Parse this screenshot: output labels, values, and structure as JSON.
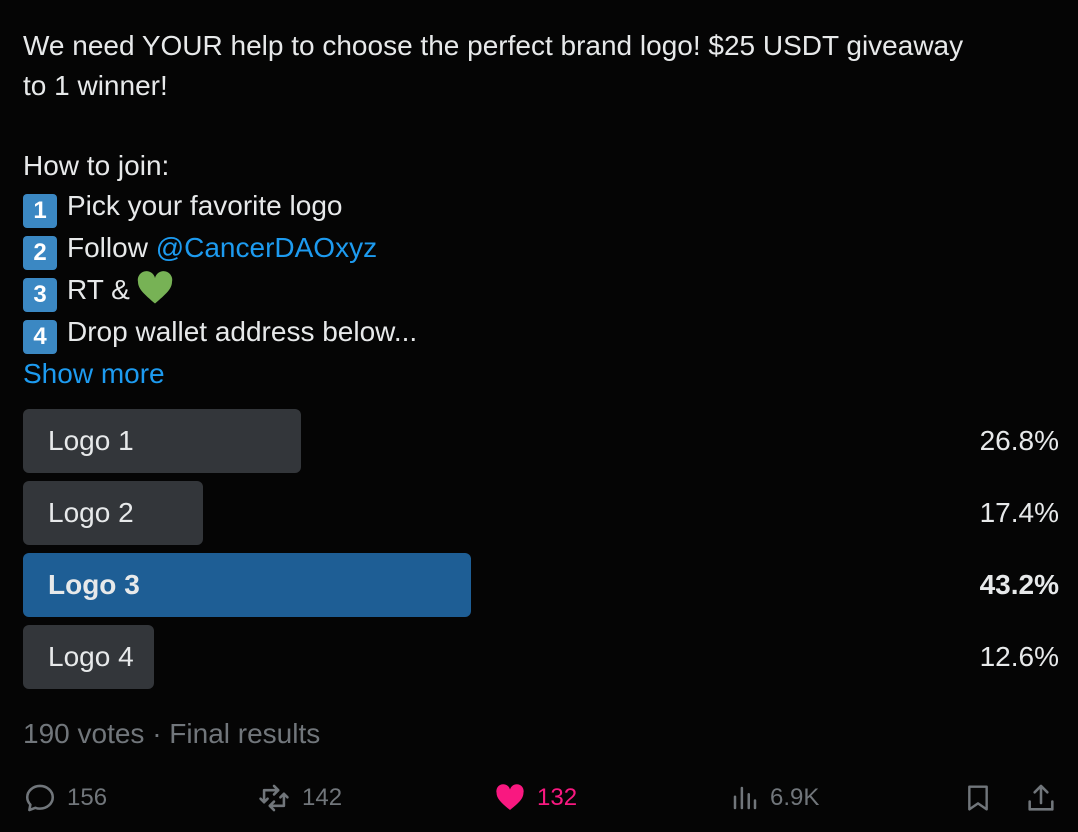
{
  "tweet": {
    "line1": "We need YOUR help to choose the perfect brand logo! $25 USDT giveaway",
    "line2": "to 1 winner!",
    "how_to_join": "How to join:",
    "steps": [
      {
        "num": "1",
        "text": "Pick your favorite logo"
      },
      {
        "num": "2",
        "text": "Follow ",
        "mention": "@CancerDAOxyz"
      },
      {
        "num": "3",
        "text": "RT &"
      },
      {
        "num": "4",
        "text": "Drop wallet address below..."
      }
    ],
    "show_more": "Show more"
  },
  "poll": {
    "options": [
      {
        "label": "Logo 1",
        "percent_text": "26.8%",
        "percent": 26.8,
        "winner": false
      },
      {
        "label": "Logo 2",
        "percent_text": "17.4%",
        "percent": 17.4,
        "winner": false
      },
      {
        "label": "Logo 3",
        "percent_text": "43.2%",
        "percent": 43.2,
        "winner": true
      },
      {
        "label": "Logo 4",
        "percent_text": "12.6%",
        "percent": 12.6,
        "winner": false
      }
    ],
    "meta": "190 votes · Final results"
  },
  "actions": {
    "replies": "156",
    "reposts": "142",
    "likes": "132",
    "views": "6.9K"
  },
  "colors": {
    "accent": "#1d9bf0",
    "winner_bar": "#1e5e95",
    "bar": "#33363a",
    "like": "#f91880"
  }
}
